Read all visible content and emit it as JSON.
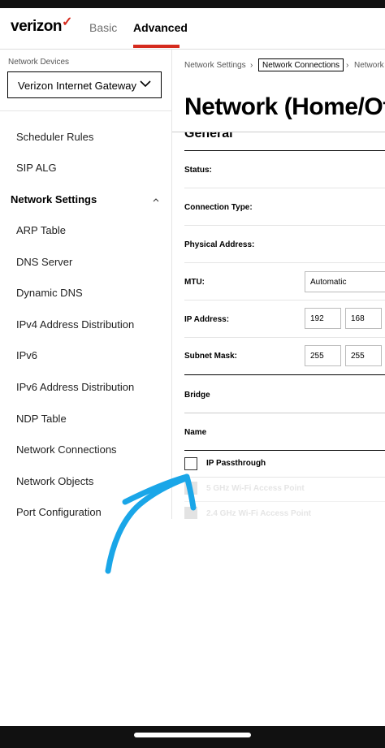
{
  "header": {
    "brand": "verizon",
    "brand_mark": "✓",
    "tabs": [
      {
        "label": "Basic",
        "active": false
      },
      {
        "label": "Advanced",
        "active": true
      }
    ],
    "accent_color": "#d52b1e"
  },
  "sidebar": {
    "device_label": "Network Devices",
    "device_select_value": "Verizon Internet Gateway",
    "items_top": [
      "Scheduler Rules",
      "SIP ALG"
    ],
    "group_title": "Network Settings",
    "group_items": [
      "ARP Table",
      "DNS Server",
      "Dynamic DNS",
      "IPv4 Address Distribution",
      "IPv6",
      "IPv6 Address Distribution",
      "NDP Table",
      "Network Connections",
      "Network Objects",
      "Port Configuration"
    ]
  },
  "main": {
    "breadcrumb": {
      "first": "Network Settings",
      "current": "Network Connections",
      "next": "Network"
    },
    "title": "Network (Home/Off",
    "section_general": "General",
    "rows": {
      "status": "Status:",
      "connection_type": "Connection Type:",
      "physical_address": "Physical Address:",
      "mtu": "MTU:",
      "ip_address": "IP Address:",
      "subnet_mask": "Subnet Mask:"
    },
    "mtu_value": "Automatic",
    "ip_octets": [
      "192",
      "168"
    ],
    "mask_octets": [
      "255",
      "255"
    ],
    "bridge_title": "Bridge",
    "name_label": "Name",
    "checkboxes": [
      {
        "label": "IP Passthrough",
        "checked": false,
        "enabled": true
      },
      {
        "label": "5 GHz Wi-Fi Access Point",
        "checked": false,
        "enabled": false
      },
      {
        "label": "2.4 GHz Wi-Fi Access Point",
        "checked": false,
        "enabled": false
      }
    ]
  },
  "annotation": {
    "arrow_color": "#1aa6e8"
  }
}
